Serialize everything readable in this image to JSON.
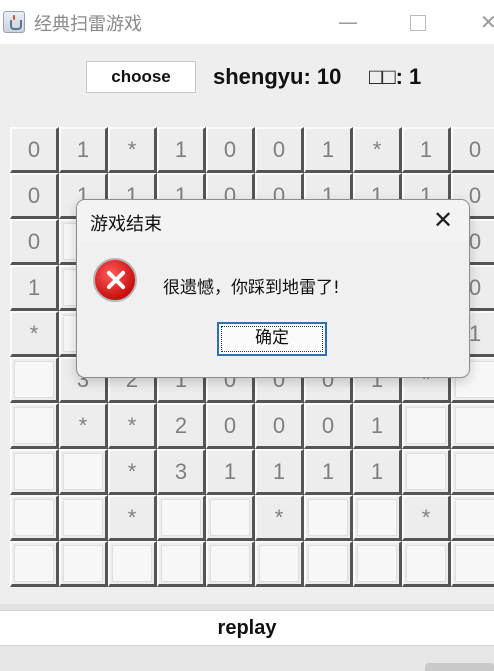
{
  "window": {
    "title": "经典扫雷游戏",
    "min_glyph": "—",
    "close_glyph": "✕"
  },
  "header": {
    "choose_label": "choose",
    "remaining_text": "shengyu: 10",
    "second_text": "□□: 1"
  },
  "grid": {
    "rows": [
      [
        "0",
        "1",
        "*",
        "1",
        "0",
        "0",
        "1",
        "*",
        "1",
        "0"
      ],
      [
        "0",
        "1",
        "1",
        "1",
        "0",
        "0",
        "1",
        "1",
        "1",
        "0"
      ],
      [
        "0",
        "",
        "",
        "",
        "",
        "",
        "",
        "",
        "",
        "0"
      ],
      [
        "1",
        "",
        "",
        "",
        "",
        "",
        "",
        "",
        "",
        "0"
      ],
      [
        "*",
        "",
        "",
        "",
        "",
        "",
        "",
        "",
        "",
        "1"
      ],
      [
        "",
        "3",
        "2",
        "1",
        "0",
        "0",
        "0",
        "1",
        "*",
        ""
      ],
      [
        "",
        "*",
        "*",
        "2",
        "0",
        "0",
        "0",
        "1",
        "",
        ""
      ],
      [
        "",
        "",
        "*",
        "3",
        "1",
        "1",
        "1",
        "1",
        "",
        ""
      ],
      [
        "",
        "",
        "*",
        "",
        "",
        "*",
        "",
        "",
        "*",
        ""
      ],
      [
        "",
        "",
        "",
        "",
        "",
        "",
        "",
        "",
        "",
        ""
      ]
    ]
  },
  "replay_label": "replay",
  "dialog": {
    "title": "游戏结束",
    "message": "很遗憾，你踩到地雷了!",
    "ok_label": "确定",
    "close_glyph": "✕"
  }
}
